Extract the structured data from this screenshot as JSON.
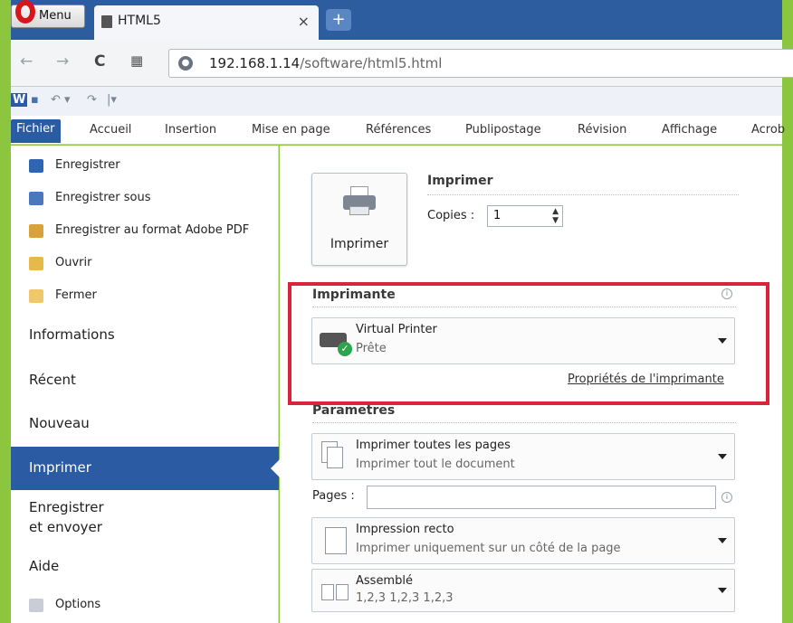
{
  "browser": {
    "menu_label": "Menu",
    "tab_title": "HTML5",
    "tab_close": "×",
    "new_tab": "+",
    "url_host": "192.168.1.14",
    "url_path": "/software/html5.html",
    "nav": {
      "back": "←",
      "forward": "→",
      "reload": "C",
      "speed_dial": "▦"
    }
  },
  "qat": {
    "word": "W",
    "save": "▪",
    "undo": "↶ ▾",
    "redo": "↷",
    "customize": "|▾"
  },
  "ribbon": {
    "tabs": [
      "Fichier",
      "Accueil",
      "Insertion",
      "Mise en page",
      "Références",
      "Publipostage",
      "Révision",
      "Affichage",
      "Acrob"
    ]
  },
  "backstage": {
    "commands": [
      "Enregistrer",
      "Enregistrer sous",
      "Enregistrer au format Adobe PDF",
      "Ouvrir",
      "Fermer"
    ],
    "sections": [
      "Informations",
      "Récent",
      "Nouveau",
      "Imprimer",
      "Enregistrer",
      "et envoyer",
      "Aide"
    ],
    "options": "Options"
  },
  "print": {
    "button_label": "Imprimer",
    "title": "Imprimer",
    "copies_label": "Copies :",
    "copies_value": "1",
    "printer_section": "Imprimante",
    "printer_name": "Virtual Printer",
    "printer_status": "Prête",
    "printer_properties": "Propriétés de l'imprimante",
    "settings_section": "Parametres",
    "settings": [
      {
        "title": "Imprimer toutes les pages",
        "subtitle": "Imprimer tout le document"
      },
      {
        "title": "Impression recto",
        "subtitle": "Imprimer uniquement sur un côté de la page"
      },
      {
        "title": "Assemblé",
        "subtitle": "1,2,3   1,2,3   1,2,3"
      }
    ],
    "pages_label": "Pages :",
    "pages_value": "",
    "info_glyph": "i"
  },
  "colors": {
    "accent": "#2a5ba3",
    "highlight": "#d8253a",
    "frame": "#8cc63f"
  }
}
